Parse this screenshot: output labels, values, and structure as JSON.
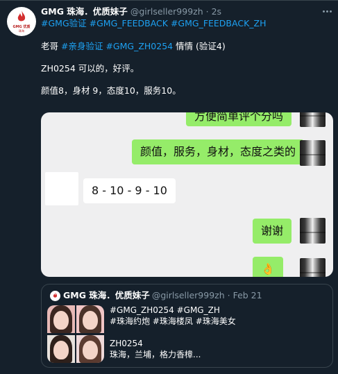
{
  "tweet": {
    "avatar": {
      "logo_top": "GMG 优质",
      "logo_bottom": "珠海"
    },
    "display_name": "GMG 珠海．优质妹子",
    "handle": "@girlseller999zh",
    "time": "· 2s",
    "tags_line": [
      "#GMG验证",
      "#GMG_FEEDBACK",
      "#GMG_FEEDBACK_ZH"
    ],
    "line2": {
      "prefix": "老哥 ",
      "tag1": "#亲身验证",
      "tag2": "#GMG_ZH0254",
      "suffix": " 情情 (验证4)"
    },
    "line3": "ZH0254 可以的，好评。",
    "line4": "颜值8，身材 9，态度10，服务10。"
  },
  "media": {
    "bubbles": [
      {
        "side": "right",
        "text": "方便简单评个分吗"
      },
      {
        "side": "right",
        "text": "颜值，服务，身材，态度之类的"
      },
      {
        "side": "left",
        "text": "8 - 10 - 9 - 10"
      },
      {
        "side": "right",
        "text": "谢谢"
      },
      {
        "side": "right",
        "text": "👌"
      }
    ]
  },
  "quote": {
    "avatar": {
      "icon": "flame-logo"
    },
    "display_name": "GMG 珠海．优质妹子",
    "handle": "@girlseller999zh · Feb 21",
    "lines": [
      "#GMG_ZH0254 #GMG_ZH",
      "#珠海约炮 #珠海楼凤 #珠海美女",
      "",
      "ZH0254",
      "珠海，兰埔，格力香樟..."
    ]
  },
  "colors": {
    "background": "#15202b",
    "link": "#1da1f2",
    "muted": "#8899a6",
    "wechat_green": "#95ec69"
  }
}
